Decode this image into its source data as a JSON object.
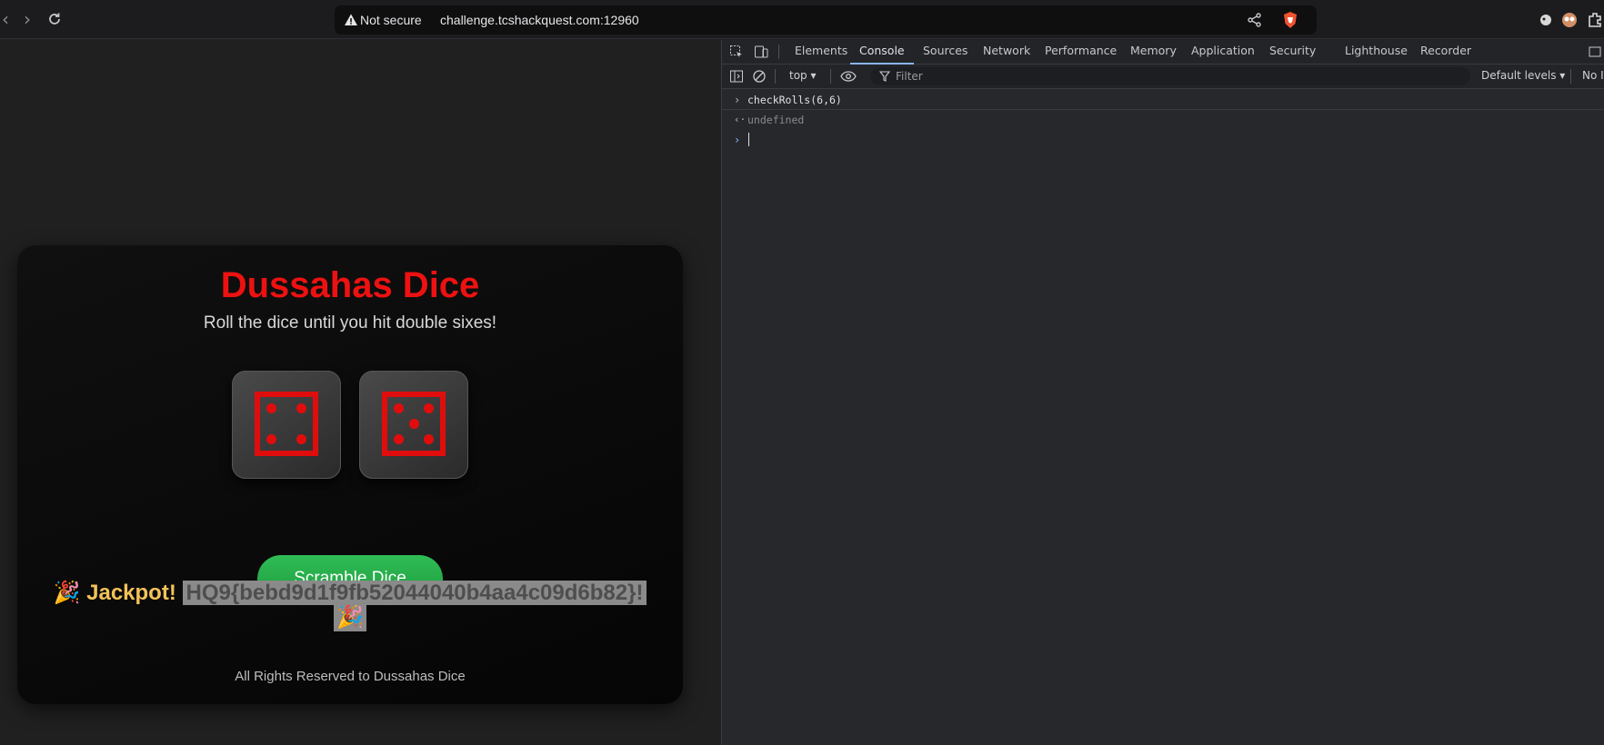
{
  "browser": {
    "security_label": "Not secure",
    "url": "challenge.tcshackquest.com:12960",
    "icons": [
      "back-icon",
      "forward-icon",
      "reload-icon",
      "warning-icon",
      "share-icon",
      "brave-shield-icon",
      "extension-icon"
    ]
  },
  "game": {
    "title": "Dussahas Dice",
    "subtitle": "Roll the dice until you hit double sixes!",
    "dice": [
      4,
      5
    ],
    "button_label": "Scramble Dice",
    "jackpot_emoji": "🎉",
    "jackpot_label": "Jackpot!",
    "flag": "HQ9{bebd9d1f9fb52044040b4aa4c09d6b82}!",
    "jackpot_emoji_end": "🎉",
    "footer": "All Rights Reserved to Dussahas Dice",
    "colors": {
      "accent": "#ee1111",
      "button": "#28b04a",
      "jackpot": "#f3c25a"
    }
  },
  "devtools": {
    "tabs": [
      "Elements",
      "Console",
      "Sources",
      "Network",
      "Performance",
      "Memory",
      "Application",
      "Security",
      "Lighthouse",
      "Recorder"
    ],
    "active_tab": "Console",
    "context": "top",
    "filter_placeholder": "Filter",
    "levels": "Default levels",
    "issues": "No Is",
    "console_lines": [
      {
        "type": "input",
        "text": "checkRolls(6,6)"
      },
      {
        "type": "output",
        "text": "undefined"
      }
    ]
  }
}
